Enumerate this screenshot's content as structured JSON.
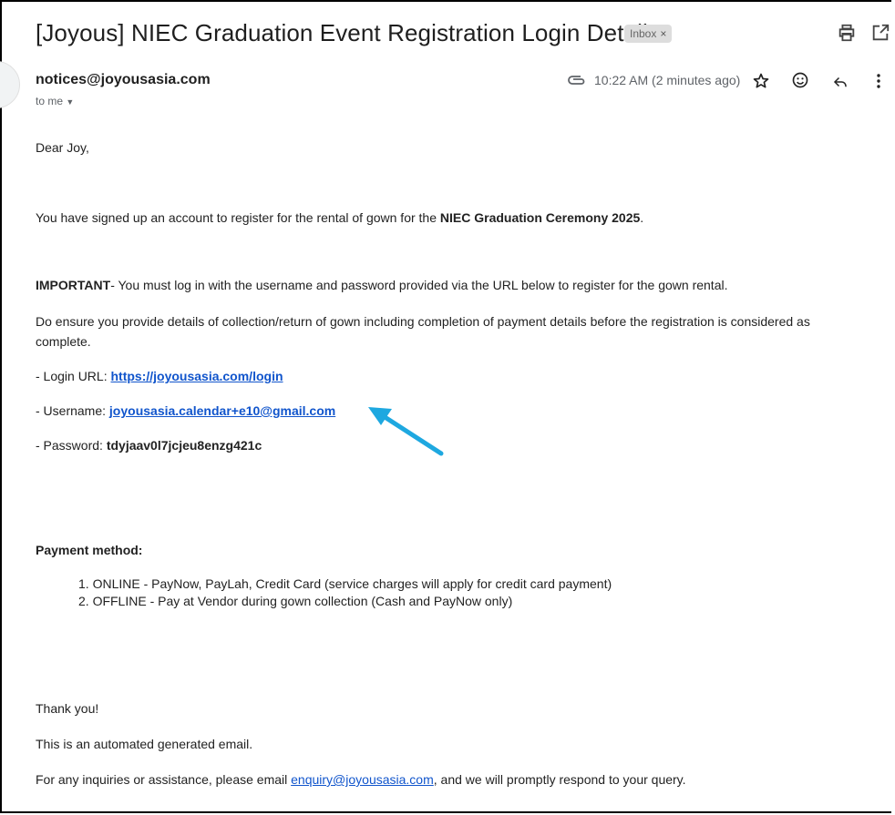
{
  "email": {
    "subject": "[Joyous] NIEC Graduation Event Registration Login Details",
    "label_chip": "Inbox",
    "label_close": "×",
    "sender": "notices@joyousasia.com",
    "to_line": "to me",
    "time": "10:22 AM (2 minutes ago)"
  },
  "body": {
    "greeting": "Dear Joy,",
    "signup_prefix": "You have signed up an account to register for the rental of gown for the ",
    "signup_event": "NIEC Graduation Ceremony 2025",
    "signup_suffix": ".",
    "important_label": "IMPORTANT",
    "important_text": "- You must log in with the username and password provided via the URL below to register for the gown rental.",
    "ensure_line1": "Do ensure you provide details of collection/return of gown including completion of payment details before the registration is considered as",
    "ensure_line2": "complete.",
    "login_label": "- Login URL: ",
    "login_url": "https://joyousasia.com/login",
    "username_label": "- Username: ",
    "username": "joyousasia.calendar+e10@gmail.com",
    "password_label": "- Password: ",
    "password": "tdyjaav0l7jcjeu8enzg421c",
    "payment_heading": "Payment method:",
    "payment_methods": [
      "1. ONLINE - PayNow, PayLah, Credit Card (service charges will apply for credit card payment)",
      "2. OFFLINE - Pay at Vendor during gown collection (Cash and PayNow only)"
    ],
    "thanks": "Thank you!",
    "automated": "This is an automated generated email.",
    "inquiry_prefix": "For any inquiries or assistance, please email ",
    "inquiry_email": "enquiry@joyousasia.com",
    "inquiry_suffix": ", and we will promptly respond to your query."
  },
  "icons": {
    "print": "print-icon",
    "open_new_window": "open-in-new-icon",
    "attachment": "attachment-icon",
    "star": "star-icon",
    "emoji": "emoji-icon",
    "reply": "reply-icon",
    "more": "more-vert-icon",
    "annotation_arrow": "arrow-annotation"
  },
  "colors": {
    "link": "#1155cc",
    "annotation_arrow": "#1ea8e0",
    "chip_bg": "#dddddd"
  }
}
